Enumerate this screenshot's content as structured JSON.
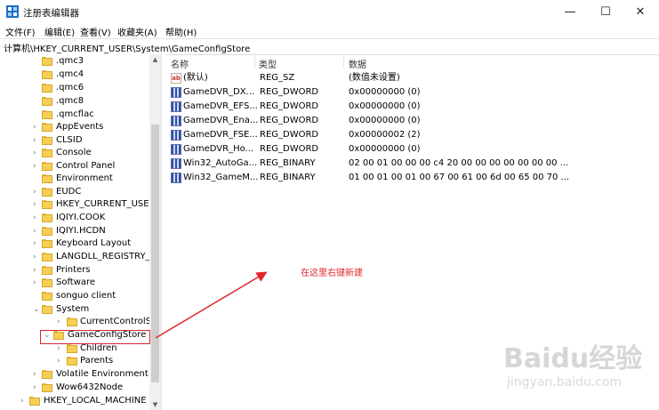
{
  "window": {
    "title": "注册表编辑器",
    "minimize_glyph": "—",
    "maximize_glyph": "☐",
    "close_glyph": "✕"
  },
  "menu": [
    "文件(F)",
    "编辑(E)",
    "查看(V)",
    "收藏夹(A)",
    "帮助(H)"
  ],
  "address": "计算机\\HKEY_CURRENT_USER\\System\\GameConfigStore",
  "tree": [
    {
      "label": ".qmc3",
      "chevron": ""
    },
    {
      "label": ".qmc4",
      "chevron": ""
    },
    {
      "label": ".qmc6",
      "chevron": ""
    },
    {
      "label": ".qmc8",
      "chevron": ""
    },
    {
      "label": ".qmcflac",
      "chevron": ""
    },
    {
      "label": "AppEvents",
      "chevron": "›"
    },
    {
      "label": "CLSID",
      "chevron": "›"
    },
    {
      "label": "Console",
      "chevron": "›"
    },
    {
      "label": "Control Panel",
      "chevron": "›"
    },
    {
      "label": "Environment",
      "chevron": ""
    },
    {
      "label": "EUDC",
      "chevron": "›"
    },
    {
      "label": "HKEY_CURRENT_USER",
      "chevron": "›"
    },
    {
      "label": "IQIYI.COOK",
      "chevron": "›"
    },
    {
      "label": "IQIYI.HCDN",
      "chevron": "›"
    },
    {
      "label": "Keyboard Layout",
      "chevron": "›"
    },
    {
      "label": "LANGDLL_REGISTRY_I",
      "chevron": "›"
    },
    {
      "label": "Printers",
      "chevron": "›"
    },
    {
      "label": "Software",
      "chevron": "›"
    },
    {
      "label": "songuo client",
      "chevron": ""
    },
    {
      "label": "System",
      "chevron": "⌄"
    },
    {
      "label": "CurrentControlSet",
      "chevron": "›"
    },
    {
      "label": "GameConfigStore",
      "chevron": "⌄"
    },
    {
      "label": "Children",
      "chevron": "›"
    },
    {
      "label": "Parents",
      "chevron": "›"
    },
    {
      "label": "Volatile Environment",
      "chevron": "›"
    },
    {
      "label": "Wow6432Node",
      "chevron": "›"
    },
    {
      "label": "HKEY_LOCAL_MACHINE",
      "chevron": "›"
    }
  ],
  "columns": {
    "name": "名称",
    "type": "类型",
    "data": "数据"
  },
  "values": [
    {
      "icon": "string-value-icon",
      "name": "(默认)",
      "type": "REG_SZ",
      "data": "(数值未设置)"
    },
    {
      "icon": "binary-value-icon",
      "name": "GameDVR_DX...",
      "type": "REG_DWORD",
      "data": "0x00000000 (0)"
    },
    {
      "icon": "binary-value-icon",
      "name": "GameDVR_EFS...",
      "type": "REG_DWORD",
      "data": "0x00000000 (0)"
    },
    {
      "icon": "binary-value-icon",
      "name": "GameDVR_Ena...",
      "type": "REG_DWORD",
      "data": "0x00000000 (0)"
    },
    {
      "icon": "binary-value-icon",
      "name": "GameDVR_FSE...",
      "type": "REG_DWORD",
      "data": "0x00000002 (2)"
    },
    {
      "icon": "binary-value-icon",
      "name": "GameDVR_Ho...",
      "type": "REG_DWORD",
      "data": "0x00000000 (0)"
    },
    {
      "icon": "binary-value-icon",
      "name": "Win32_AutoGa...",
      "type": "REG_BINARY",
      "data": "02 00 01 00 00 00 c4 20 00 00 00 00 00 00 00 ..."
    },
    {
      "icon": "binary-value-icon",
      "name": "Win32_GameM...",
      "type": "REG_BINARY",
      "data": "01 00 01 00 01 00 67 00 61 00 6d 00 65 00 70 ..."
    }
  ],
  "annotation": {
    "text": "在这里右键新建",
    "color": "#e0262b"
  },
  "watermark": {
    "logo": "Baidu经验",
    "sub": "jingyan.baidu.com"
  },
  "colors": {
    "folder": "#f6cf55",
    "highlight": "#d9262c"
  }
}
